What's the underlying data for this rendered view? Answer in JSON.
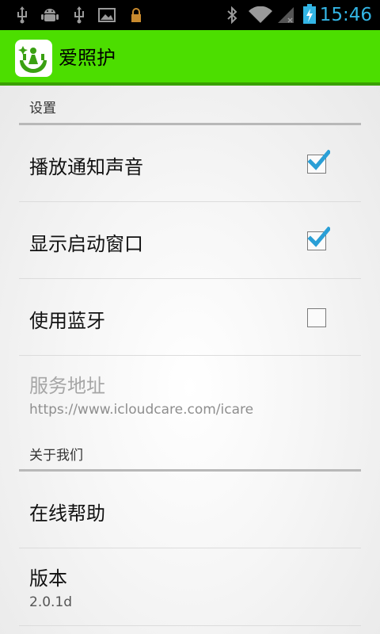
{
  "status_bar": {
    "time": "15:46",
    "left_icons": [
      "usb-icon",
      "android-debug-icon",
      "usb-icon",
      "image-icon",
      "lock-icon"
    ],
    "right_icons": [
      "bluetooth-icon",
      "wifi-icon",
      "signal-icon",
      "battery-charging-icon"
    ],
    "accent_color": "#33b5e5"
  },
  "action_bar": {
    "title": "爱照护",
    "background": "#4cde00"
  },
  "settings": {
    "category_settings": "设置",
    "items": [
      {
        "title": "播放通知声音",
        "checked": true
      },
      {
        "title": "显示启动窗口",
        "checked": true
      },
      {
        "title": "使用蓝牙",
        "checked": false
      }
    ],
    "server": {
      "title": "服务地址",
      "value": "https://www.icloudcare.com/icare"
    },
    "category_about": "关于我们",
    "help": {
      "title": "在线帮助"
    },
    "version": {
      "title": "版本",
      "value": "2.0.1d"
    }
  }
}
